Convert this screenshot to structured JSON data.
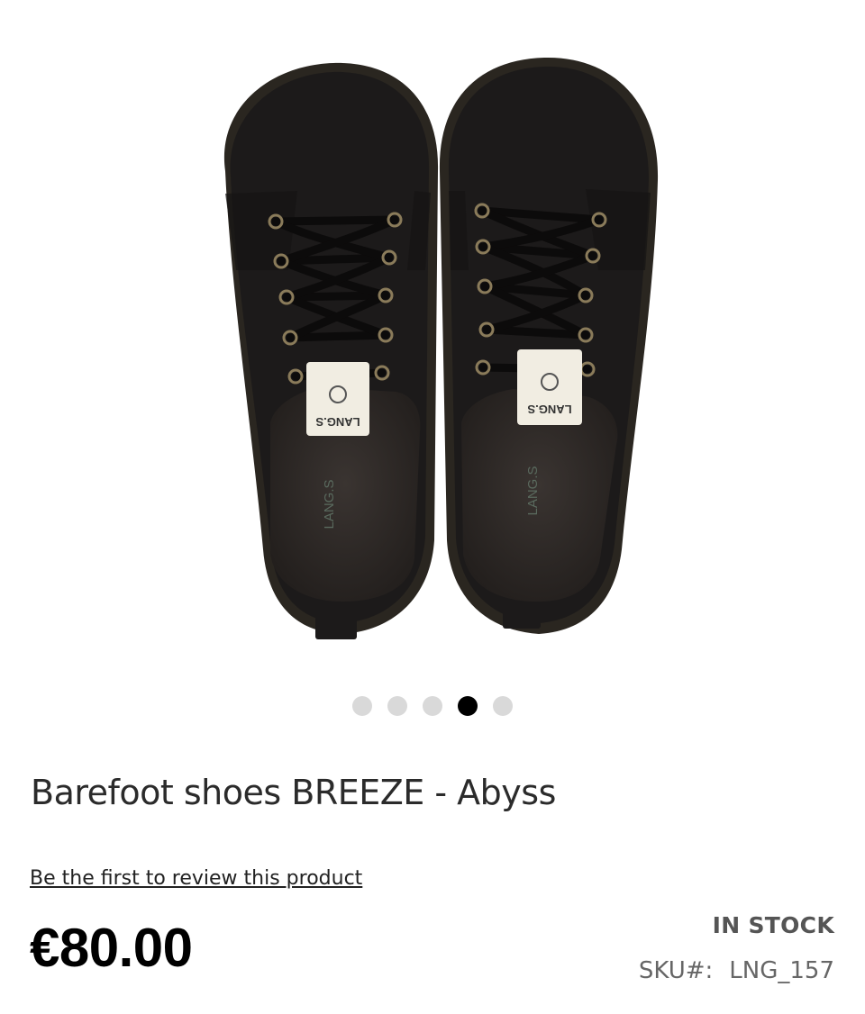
{
  "product": {
    "title": "Barefoot shoes BREEZE - Abyss",
    "review_link": "Be the first to review this product",
    "price": "€80.00",
    "stock_status": "IN STOCK",
    "sku_label": "SKU#:",
    "sku_value": "LNG_157",
    "brand_tag": "LANG.S"
  },
  "gallery": {
    "image_count": 5,
    "active_index": 4
  },
  "colors": {
    "shoe": "#1c1a1a",
    "sole": "#2a2620",
    "dot_active": "#000000",
    "dot_inactive": "#d9d9d9"
  }
}
